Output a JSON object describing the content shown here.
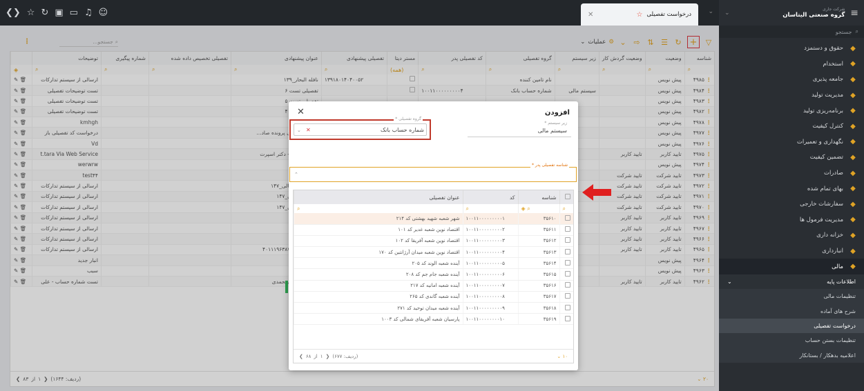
{
  "app": {
    "org_small": "شرکت جاری",
    "org_name": "گروه صنعتی الیتاسان",
    "tab_title": "درخواست تفصیلی"
  },
  "sidebar": {
    "search_placeholder": "جستجو",
    "items": [
      {
        "label": "حقوق و دستمزد",
        "icon": "wallet-icon"
      },
      {
        "label": "استخدام",
        "icon": "user-icon"
      },
      {
        "label": "جامعه پذیری",
        "icon": "group-icon"
      },
      {
        "label": "مدیریت تولید",
        "icon": "factory-icon"
      },
      {
        "label": "برنامه‌ریزی تولید",
        "icon": "planning-icon"
      },
      {
        "label": "کنترل کیفیت",
        "icon": "quality-icon"
      },
      {
        "label": "نگهداری و تعمیرات",
        "icon": "wrench-icon"
      },
      {
        "label": "تضمین کیفیت",
        "icon": "badge-icon"
      },
      {
        "label": "صادرات",
        "icon": "globe-icon"
      },
      {
        "label": "بهای تمام شده",
        "icon": "chart-icon"
      },
      {
        "label": "سفارشات خارجی",
        "icon": "box-icon"
      },
      {
        "label": "مدیریت فرمول ها",
        "icon": "formula-icon"
      },
      {
        "label": "خزانه داری",
        "icon": "bank-icon"
      },
      {
        "label": "انبارداری",
        "icon": "warehouse-icon"
      },
      {
        "label": "مالی",
        "icon": "finance-icon"
      }
    ],
    "submenu_header": "اطلاعات پایه",
    "submenu": [
      {
        "label": "تنظیمات مالی"
      },
      {
        "label": "شرح های آماده"
      },
      {
        "label": "درخواست تفصیلی"
      },
      {
        "label": "تنظیمات بستن حساب"
      },
      {
        "label": "اعلامیه بدهکار / بستانکار"
      }
    ]
  },
  "toolbar": {
    "operations_label": "عملیات",
    "search_placeholder": "جستجو..."
  },
  "grid": {
    "columns": [
      "شناسه",
      "وضعیت",
      "وضعیت گردش کار",
      "زیر سیستم",
      "گروه تفصیلی",
      "کد تفصیلی پدر",
      "مستر دیتا",
      "تفصیلی پیشنهادی",
      "عنوان پیشنهادی",
      "تفصیلی تخصیص داده شده",
      "شماره پیگیری",
      "توضیحات"
    ],
    "master_filter": "(همه)",
    "rows": [
      {
        "id": "۴۹۸۵",
        "status": "پیش نویس",
        "workflow": "",
        "subsys": "",
        "group": "نام تامین کننده",
        "parent": "",
        "proposed": "۱۳۹۱۸۰۱۴۰۴۰۰۵۲",
        "title": "نافله البحار_۱۳۹",
        "desc": "ارسالی از سیستم تدارکات"
      },
      {
        "id": "۴۹۸۴",
        "status": "پیش نویس",
        "workflow": "",
        "subsys": "سیستم مالی",
        "group": "شماره حساب بانک",
        "parent": "۱۰۰۱۱۰۰۰۰۰۰۰۰۰۴",
        "proposed": "",
        "title": "تفصیلی تست ۶",
        "desc": "تست توضیحات تفصیلی"
      },
      {
        "id": "۴۹۸۳",
        "status": "پیش نویس",
        "workflow": "",
        "subsys": "",
        "group": "",
        "parent": "",
        "proposed": "",
        "title": "تفصیلی تست ۵",
        "desc": "تست توضیحات تفصیلی"
      },
      {
        "id": "۴۹۸۲",
        "status": "پیش نویس",
        "workflow": "",
        "subsys": "",
        "group": "",
        "parent": "",
        "proposed": "",
        "title": "تفصیلی تست ۴",
        "desc": "تست توضیحات تفصیلی"
      },
      {
        "id": "۴۹۷۸",
        "status": "پیش نویس",
        "workflow": "",
        "subsys": "",
        "group": "",
        "parent": "",
        "proposed": "",
        "title": "",
        "desc": "kmhgh"
      },
      {
        "id": "۴۹۷۷",
        "status": "پیش نویس",
        "workflow": "",
        "subsys": "",
        "group": "",
        "parent": "",
        "proposed": "",
        "title": "د تفصیلی برای پرونده صاد...",
        "desc": "درخواست کد تفصیلی باز"
      },
      {
        "id": "۴۹۷۶",
        "status": "پیش نویس",
        "workflow": "",
        "subsys": "",
        "group": "",
        "parent": "",
        "proposed": "",
        "title": "",
        "desc": "Vd"
      },
      {
        "id": "۴۹۷۵",
        "status": "تایید کاربر",
        "workflow": "تایید کاربر",
        "subsys": "",
        "group": "",
        "parent": "",
        "proposed": "",
        "title": "دارتی رضوی - دکتر اسپرت",
        "desc": "t.tara Via Web Service"
      },
      {
        "id": "۴۹۷۴",
        "status": "پیش نویس",
        "workflow": "",
        "subsys": "",
        "group": "",
        "parent": "",
        "proposed": "",
        "title": "",
        "desc": "werwrw"
      },
      {
        "id": "۴۹۷۳",
        "status": "تایید شرکت",
        "workflow": "تایید شرکت",
        "subsys": "",
        "group": "",
        "parent": "",
        "proposed": "",
        "title": "",
        "desc": "test۴۴"
      },
      {
        "id": "۴۹۷۲",
        "status": "تایید شرکت",
        "workflow": "تایید شرکت",
        "subsys": "",
        "group": "",
        "parent": "",
        "proposed": "۱۴۷_",
        "title": "ی قاب های مالی_۱۴۷",
        "desc": "ارسالی از سیستم تدارکات"
      },
      {
        "id": "۴۹۷۱",
        "status": "تایید شرکت",
        "workflow": "تایید شرکت",
        "subsys": "",
        "group": "",
        "parent": "",
        "proposed": "۱۴۷_",
        "title": "قاب های مالی_۱۴۷",
        "desc": "ارسالی از سیستم تدارکات"
      },
      {
        "id": "۴۹۷۰",
        "status": "تایید شرکت",
        "workflow": "تایید شرکت",
        "subsys": "",
        "group": "",
        "parent": "",
        "proposed": "۱۴۷_",
        "title": "قاب های مالی_۱۴۷",
        "desc": "ارسالی از سیستم تدارکات"
      },
      {
        "id": "۴۹۶۹",
        "status": "تایید کاربر",
        "workflow": "تایید کاربر",
        "subsys": "",
        "group": "",
        "parent": "",
        "proposed": "",
        "title": "",
        "desc": "ارسالی از سیستم تدارکات"
      },
      {
        "id": "۴۹۶۷",
        "status": "تایید کاربر",
        "workflow": "تایید کاربر",
        "subsys": "",
        "group": "",
        "parent": "",
        "proposed": "",
        "title": "",
        "desc": "ارسالی از سیستم تدارکات"
      },
      {
        "id": "۴۹۶۶",
        "status": "تایید کاربر",
        "workflow": "تایید کاربر",
        "subsys": "",
        "group": "",
        "parent": "",
        "proposed": "",
        "title": "",
        "desc": "ارسالی از سیستم تدارکات"
      },
      {
        "id": "۴۹۶۵",
        "status": "تایید کاربر",
        "workflow": "تایید کاربر",
        "subsys": "",
        "group": "",
        "parent": "",
        "proposed": "۴۰۱۱۱۹۶۳۸۷ ...",
        "title": "شیمی پارسا ۴۰۱۱۱۹۶۳۸۷",
        "desc": "ارسالی از سیستم تدارکات"
      },
      {
        "id": "۴۹۶۴",
        "status": "پیش نویس",
        "workflow": "",
        "subsys": "",
        "group": "",
        "parent": "",
        "proposed": "",
        "title": "گودرزی_۱۳۹",
        "desc": "انبار جدید"
      },
      {
        "id": "۴۹۶۳",
        "status": "پیش نویس",
        "workflow": "",
        "subsys": "",
        "group": "",
        "parent": "",
        "proposed": "",
        "title": "",
        "desc": "سبب"
      },
      {
        "id": "۴۹۶۲",
        "status": "تایید کاربر",
        "workflow": "تایید کاربر",
        "subsys": "",
        "group": "",
        "parent": "",
        "proposed": "",
        "title": "ه حساب - علیمحمدی",
        "desc": "تست شماره حساب - علی"
      }
    ],
    "footer_page": "۱",
    "footer_of": "از",
    "footer_total_pages": "۸۳",
    "footer_rows": "(ردیف: ۱۶۴۴)",
    "page_size": "۲۰"
  },
  "modal": {
    "title": "افزودن",
    "subsys_label": "زیر سیستم *",
    "subsys_value": "سیستم مالی",
    "group_label": "گروه تفصیلی *",
    "group_value": "شماره حساب بانک",
    "parent_label": "شناسه تفصیلی پدر *",
    "columns": [
      "شناسه",
      "کد",
      "عنوان تفصیلی"
    ],
    "rows": [
      {
        "id": "۳۵۶۱۰",
        "code": "۱۰۰۱۱۰۰۰۰۰۰۰۰۰۱",
        "title": "شهر شعبه شهید بهشتی کد ۲۱۴"
      },
      {
        "id": "۳۵۶۱۱",
        "code": "۱۰۰۱۱۰۰۰۰۰۰۰۰۰۲",
        "title": "اقتصاد نوین شعبه غدیر کد ۱۰۱"
      },
      {
        "id": "۳۵۶۱۲",
        "code": "۱۰۰۱۱۰۰۰۰۰۰۰۰۰۳",
        "title": "اقتصاد نوین شعبه آفریقا کد ۱۰۲"
      },
      {
        "id": "۳۵۶۱۳",
        "code": "۱۰۰۱۱۰۰۰۰۰۰۰۰۰۴",
        "title": "اقتصاد نوین شعبه میدان آرژانتین کد ۱۷۰"
      },
      {
        "id": "۳۵۶۱۴",
        "code": "۱۰۰۱۱۰۰۰۰۰۰۰۰۰۵",
        "title": "آینده شعبه الوند کد ۲۰۵"
      },
      {
        "id": "۳۵۶۱۵",
        "code": "۱۰۰۱۱۰۰۰۰۰۰۰۰۰۶",
        "title": "آینده شعبه جام جم کد ۲۰۸"
      },
      {
        "id": "۳۵۶۱۶",
        "code": "۱۰۰۱۱۰۰۰۰۰۰۰۰۰۷",
        "title": "آینده شعبه امانیه کد ۲۱۷"
      },
      {
        "id": "۳۵۶۱۷",
        "code": "۱۰۰۱۱۰۰۰۰۰۰۰۰۰۸",
        "title": "آینده شعبه گاندی کد ۲۶۵"
      },
      {
        "id": "۳۵۶۱۸",
        "code": "۱۰۰۱۱۰۰۰۰۰۰۰۰۰۹",
        "title": "آینده شعبه میدان توحید کد ۲۷۱"
      },
      {
        "id": "۳۵۶۱۹",
        "code": "۱۰۰۱۱۰۰۰۰۰۰۰۰۱۰",
        "title": "پارسیان شعبه آفریقای شمالی کد ۱۰۰۳"
      }
    ],
    "footer_page": "۱",
    "footer_of": "از",
    "footer_total_pages": "۶۸",
    "footer_rows": "(ردیف: ۶۷۷)",
    "page_size": "۱۰"
  }
}
